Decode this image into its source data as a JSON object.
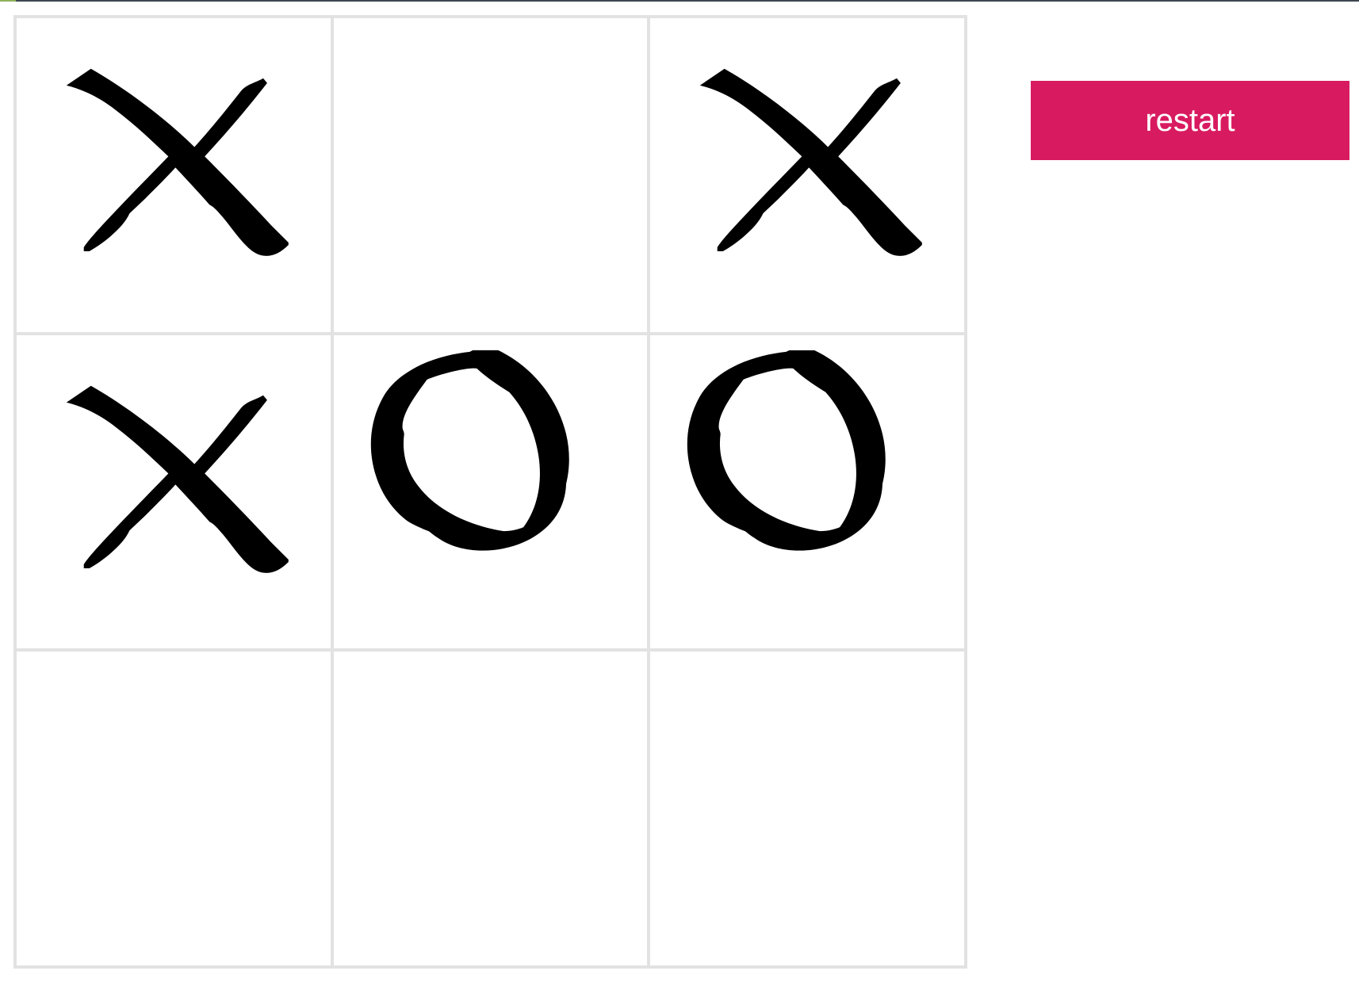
{
  "board": {
    "cells": [
      "X",
      "",
      "X",
      "X",
      "O",
      "O",
      "",
      "",
      ""
    ]
  },
  "controls": {
    "restart_label": "restart"
  },
  "colors": {
    "accent": "#d81b60",
    "grid": "#e2e2e2",
    "mark": "#000000"
  }
}
